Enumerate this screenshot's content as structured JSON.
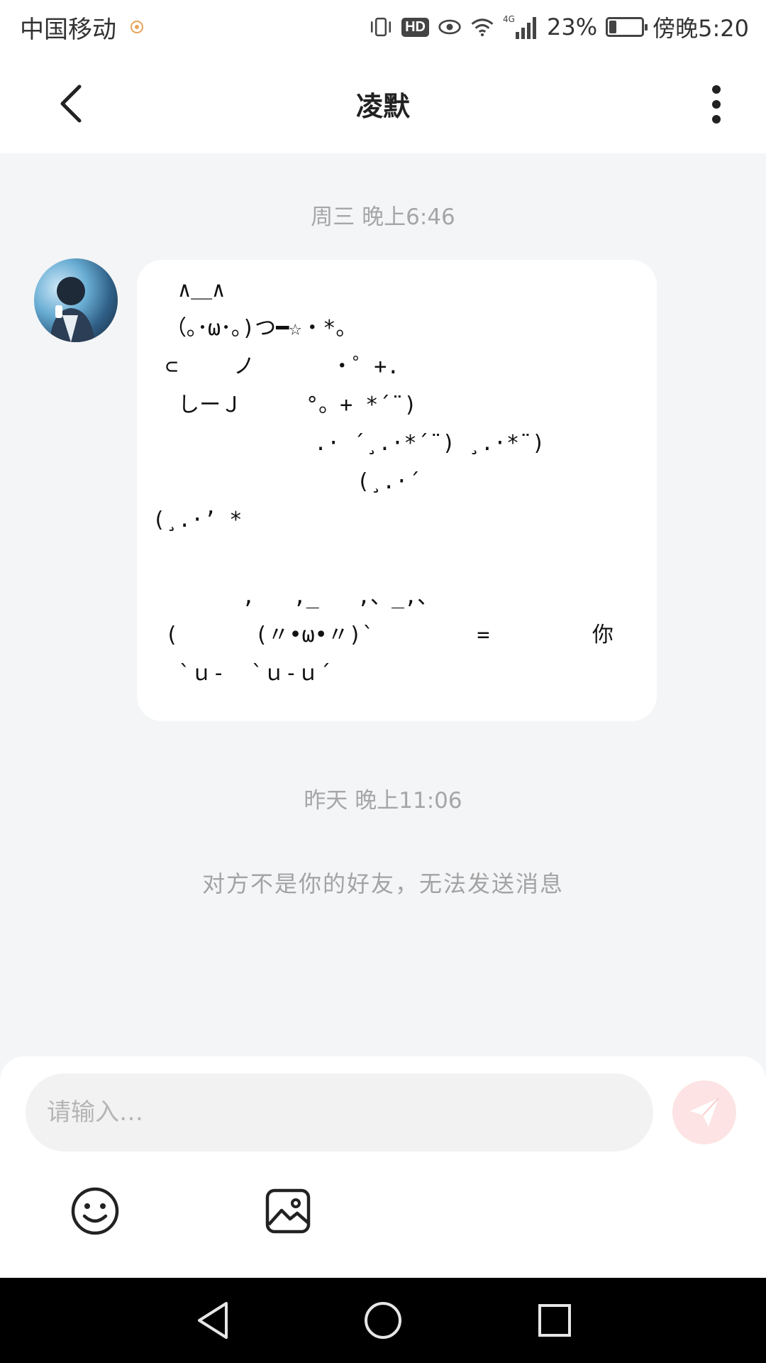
{
  "status_bar": {
    "carrier": "中国移动",
    "network": "4G",
    "hd": "HD",
    "battery_percent": "23%",
    "battery_level": 0.23,
    "time": "傍晚5:20",
    "icons": [
      "vibrate-icon",
      "hd-icon",
      "eye-icon",
      "wifi-icon",
      "signal-icon",
      "battery-icon"
    ]
  },
  "header": {
    "title": "凌默",
    "back_icon": "chevron-left-icon",
    "more_icon": "more-vertical-icon"
  },
  "chat": {
    "timestamp_1": "周三 晚上6:46",
    "message_art": "  ∧＿∧\n （｡･ω･｡)つ━☆・*。\n ⊂　　 ノ 　　　・゜+.\n  しーＪ　　　°。+ *´¨)\n 　　　　　　　.· ´¸.·*´¨) ¸.·*¨)\n 　　　　　　　　　(¸.·´\n(¸.·’ *\n\n       ,   ,_   ,、_,、\n (      (〃•ω•〃)`        =        你\n  `ｕ-  `ｕ-ｕ´",
    "timestamp_2": "昨天 晚上11:06",
    "notice": "对方不是你的好友，无法发送消息"
  },
  "composer": {
    "placeholder": "请输入…",
    "send_icon": "send-icon",
    "emoji_icon": "emoji-icon",
    "image_icon": "image-icon"
  },
  "nav": [
    "back-triangle-icon",
    "home-circle-icon",
    "recent-square-icon"
  ]
}
